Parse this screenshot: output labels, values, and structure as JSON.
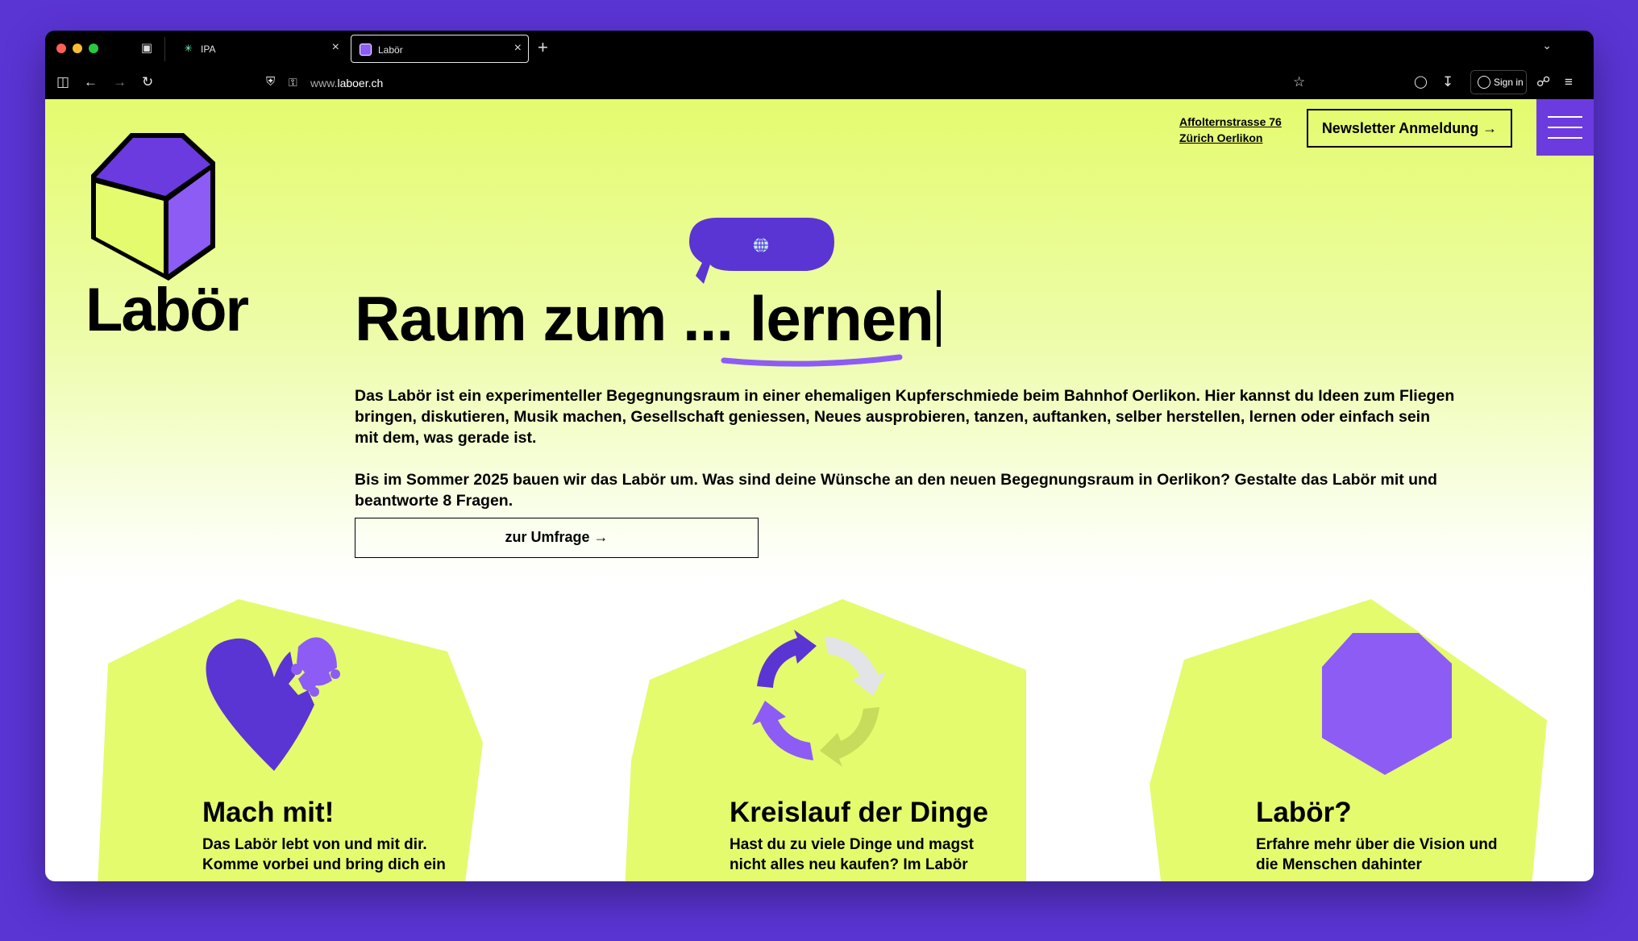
{
  "browser": {
    "tabs": [
      {
        "label": "IPA",
        "active": false
      },
      {
        "label": "Labör",
        "active": true
      }
    ],
    "new_tab_label": "+",
    "url_prefix": "www.",
    "url_domain": "laboer.ch",
    "sign_in_label": "Sign in"
  },
  "header": {
    "logo_text": "Labör",
    "address_line1": "Affolternstrasse 76",
    "address_line2": "Zürich Oerlikon",
    "newsletter_label": "Newsletter Anmeldung →"
  },
  "hero": {
    "title_prefix": "Raum zum ...",
    "title_word": "lernen",
    "paragraph1": "Das Labör ist ein experimenteller Begegnungsraum in einer ehemaligen Kupferschmiede beim Bahnhof Oerlikon. Hier kannst du Ideen zum Fliegen bringen, diskutieren, Musik machen, Gesellschaft geniessen, Neues ausprobieren, tanzen, auftanken, selber herstellen, lernen oder einfach sein mit dem, was gerade ist.",
    "paragraph2": "Bis im Sommer 2025 bauen wir das Labör um. Was sind deine Wünsche an den neuen Begegnungsraum in Oerlikon? Gestalte das Labör mit und beantworte 8 Fragen.",
    "survey_button": "zur Umfrage →"
  },
  "cards": [
    {
      "title": "Mach mit!",
      "line1": "Das Labör lebt von und mit dir.",
      "line2": "Komme vorbei und bring dich ein",
      "icon": "heart-puzzle-icon"
    },
    {
      "title": "Kreislauf der Dinge",
      "line1": "Hast du zu viele Dinge und magst",
      "line2": "nicht alles neu kaufen? Im Labör",
      "icon": "recycle-arrows-icon"
    },
    {
      "title": "Labör?",
      "line1": "Erfahre mehr über die Vision und",
      "line2": "die Menschen dahinter",
      "icon": "octagon-icon"
    }
  ],
  "colors": {
    "brand_purple": "#6b3be0",
    "brand_lime": "#e4fb6e",
    "background": "#5b34d4"
  }
}
